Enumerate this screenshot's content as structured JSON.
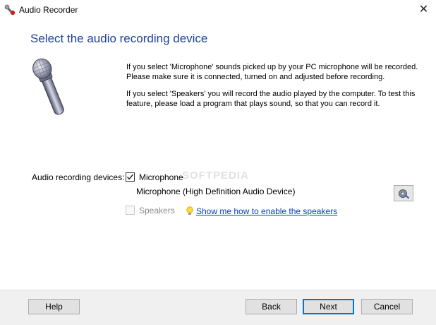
{
  "window": {
    "title": "Audio Recorder",
    "close_glyph": "✕"
  },
  "page": {
    "heading": "Select the audio recording device",
    "para_microphone": "If you select 'Microphone' sounds picked up by your PC microphone will be recorded. Please make sure it is connected, turned on and adjusted before recording.",
    "para_speakers": "If you select 'Speakers' you will record the audio played by the computer. To test this feature, please load a program that plays sound, so that you can record it."
  },
  "devices": {
    "label": "Audio recording devices:",
    "microphone": {
      "label": "Microphone",
      "checked": true,
      "device_name": "Microphone (High Definition Audio Device)"
    },
    "speakers": {
      "label": "Speakers",
      "checked": false,
      "enabled": false
    },
    "help_link": "Show me how to enable the speakers"
  },
  "watermark": "SOFTPEDIA",
  "footer": {
    "help_label": "Help",
    "back_label": "Back",
    "next_label": "Next",
    "cancel_label": "Cancel"
  },
  "icons": {
    "app": "microphone-app-icon",
    "hero": "microphone-icon",
    "settings": "audio-settings-icon",
    "hint": "lightbulb-icon"
  },
  "colors": {
    "heading": "#1e3f9a",
    "link": "#0645ad",
    "default_button_border": "#0078d7",
    "footer_bg": "#f0f0f0"
  }
}
